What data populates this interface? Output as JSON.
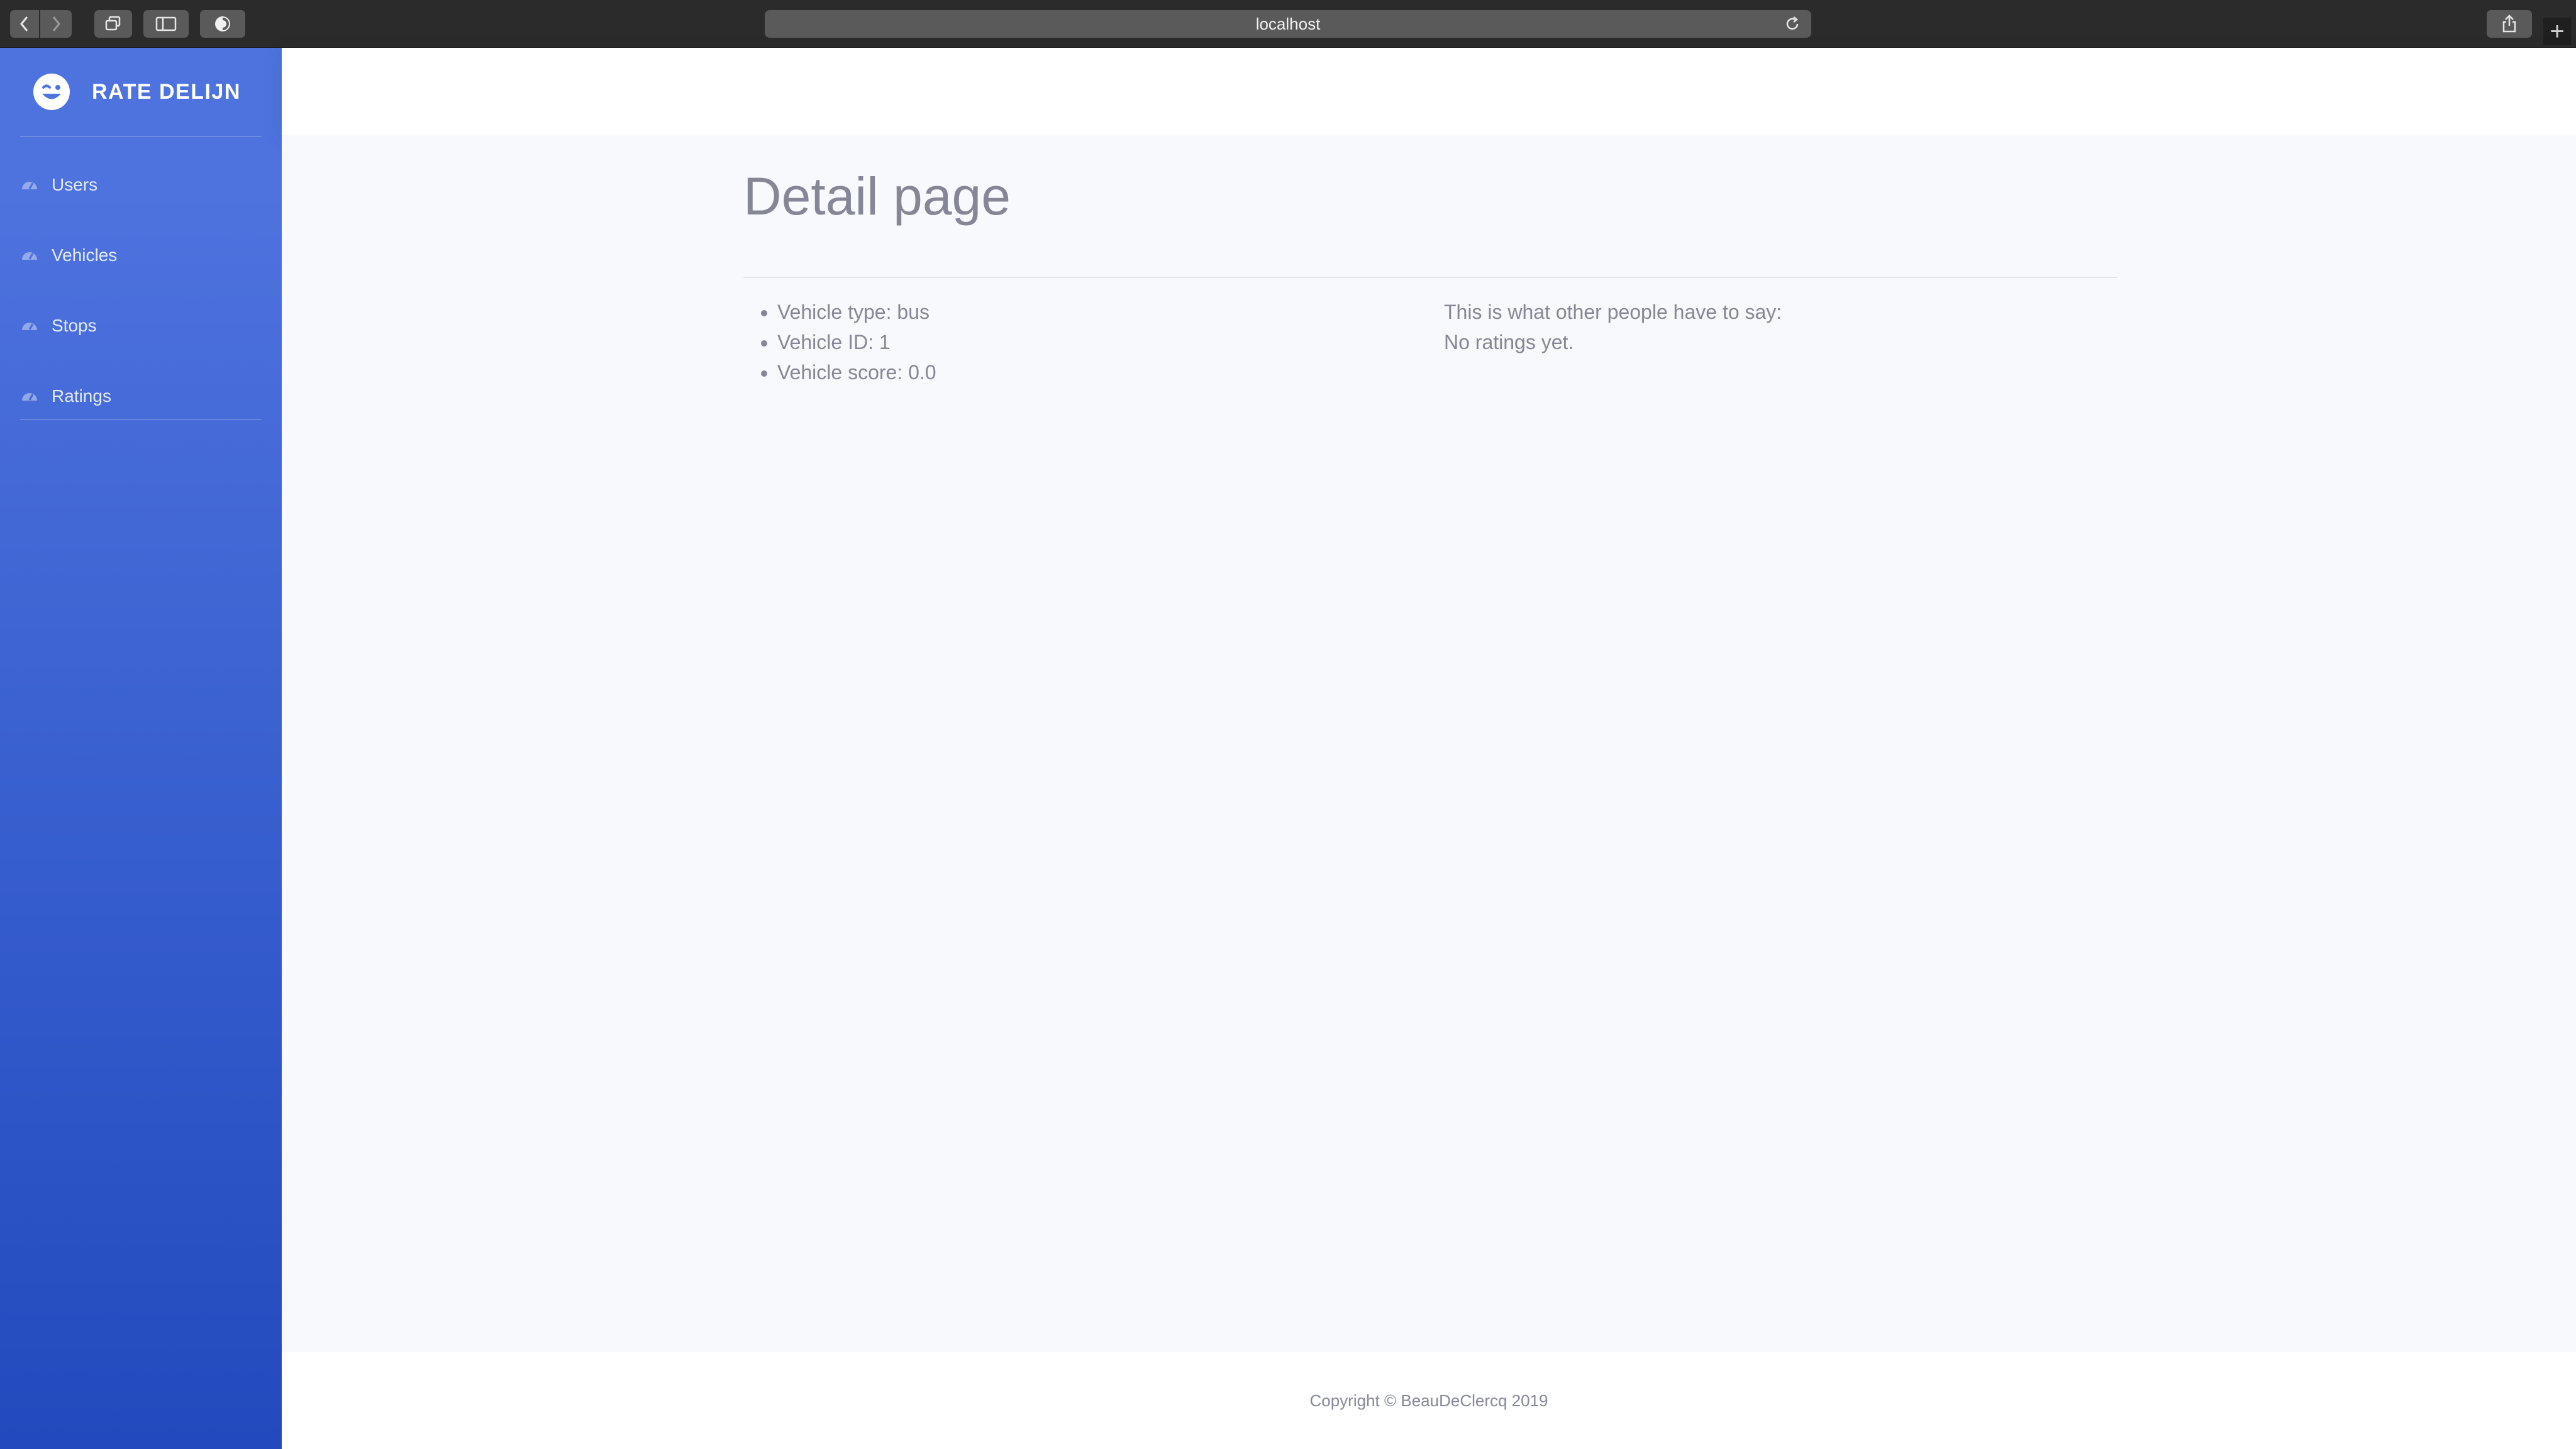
{
  "browser": {
    "url": "localhost",
    "new_tab_symbol": "+"
  },
  "sidebar": {
    "brand": {
      "icon": "grin-wink-icon",
      "label": "RATE DELIJN"
    },
    "items": [
      {
        "label": "Users",
        "icon": "tachometer-icon"
      },
      {
        "label": "Vehicles",
        "icon": "tachometer-icon"
      },
      {
        "label": "Stops",
        "icon": "tachometer-icon"
      },
      {
        "label": "Ratings",
        "icon": "tachometer-icon"
      }
    ]
  },
  "main": {
    "title": "Detail page",
    "details": [
      "Vehicle type: bus",
      "Vehicle ID: 1",
      "Vehicle score: 0.0"
    ],
    "ratings_heading": "This is what other people have to say:",
    "ratings_empty": "No ratings yet."
  },
  "footer": {
    "copyright": "Copyright © BeauDeClercq 2019"
  },
  "colors": {
    "sidebar_gradient_start": "#4e73df",
    "sidebar_gradient_end": "#224abe",
    "text_muted": "#858796",
    "page_background": "#f8f9fc"
  }
}
